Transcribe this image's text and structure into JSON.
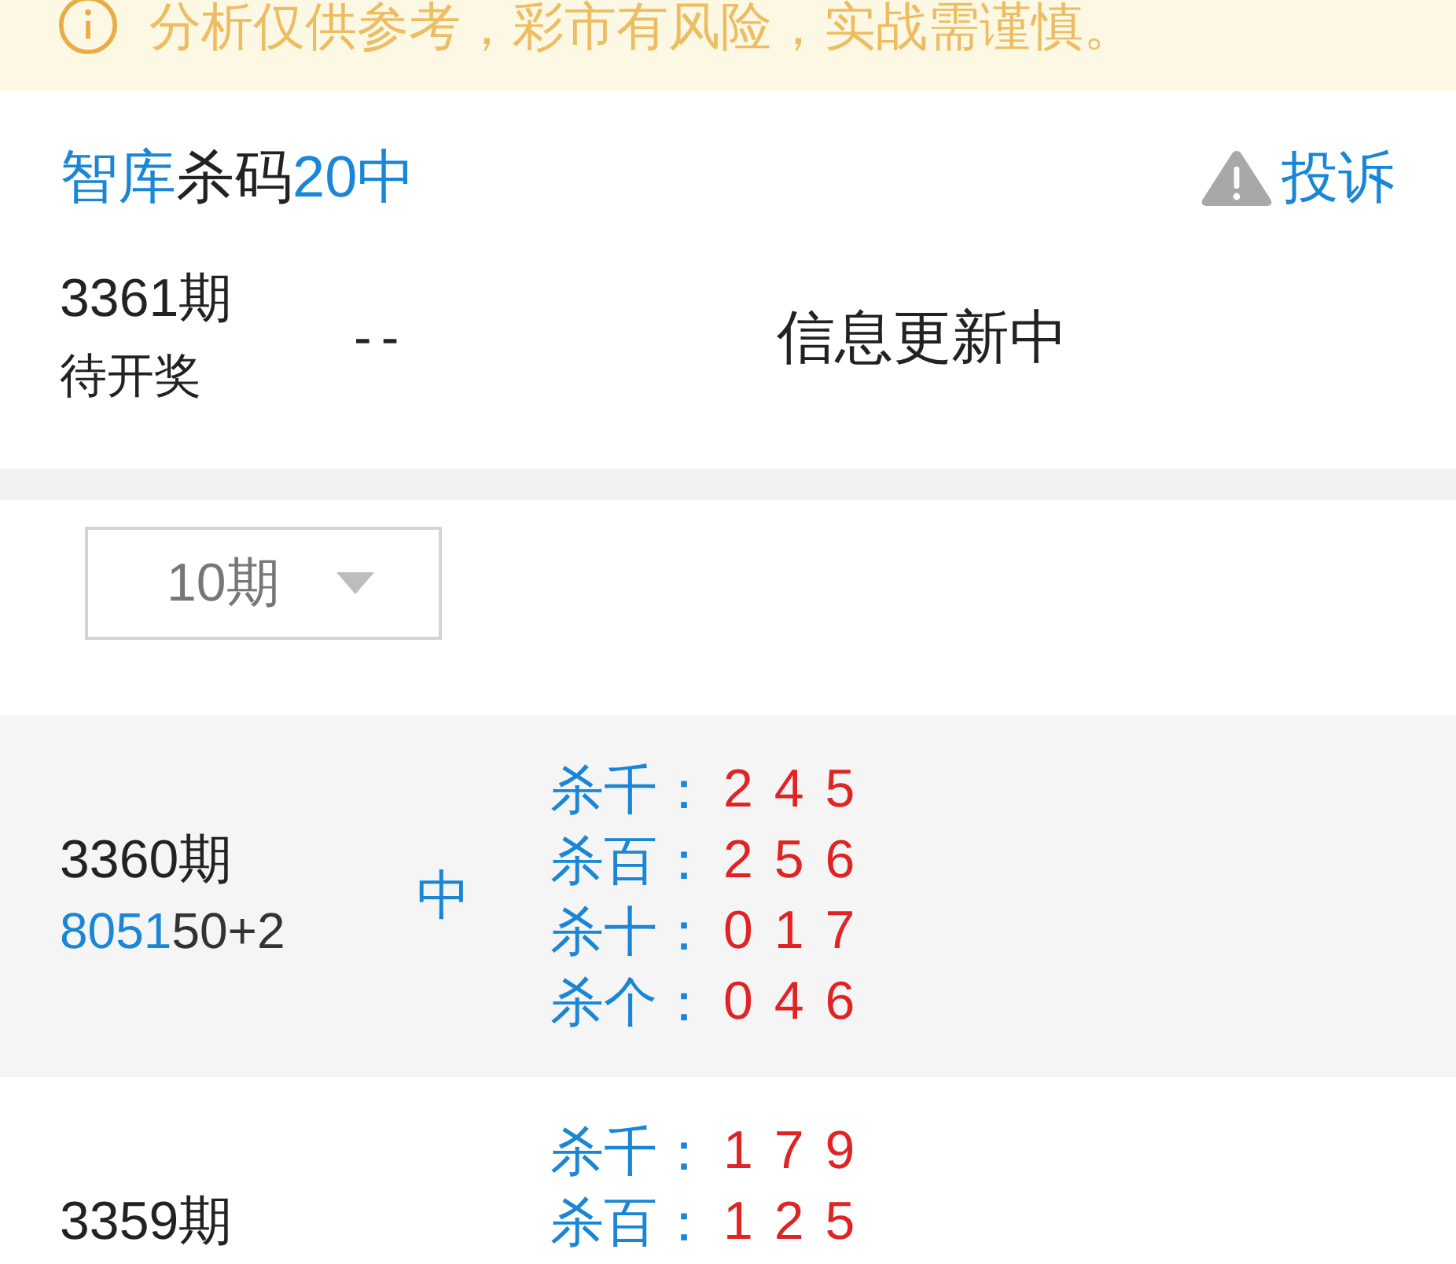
{
  "notice": {
    "text": "分析仅供参考，彩市有风险，实战需谨慎。"
  },
  "summary": {
    "title": [
      {
        "text": "智库",
        "highlight": true
      },
      {
        "text": "杀码",
        "highlight": false
      },
      {
        "text": "20中",
        "highlight": true
      }
    ],
    "report_button": "投诉",
    "current": {
      "issue": "3361期",
      "status": "待开奖",
      "numbers": "--",
      "message": "信息更新中"
    }
  },
  "filter": {
    "period": "10期"
  },
  "history": [
    {
      "issue": "3360期",
      "draw": [
        {
          "text": "8051",
          "highlight": true
        },
        {
          "text": "50+2",
          "highlight": false
        }
      ],
      "result": "中",
      "kills": [
        {
          "label": "杀千：",
          "digits": "2 4 5"
        },
        {
          "label": "杀百：",
          "digits": "2 5 6"
        },
        {
          "label": "杀十：",
          "digits": "0 1 7"
        },
        {
          "label": "杀个：",
          "digits": "0 4 6"
        }
      ]
    },
    {
      "issue": "3359期",
      "kills": [
        {
          "label": "杀千：",
          "digits": "1 7 9"
        },
        {
          "label": "杀百：",
          "digits": "1 2 5"
        }
      ]
    }
  ]
}
